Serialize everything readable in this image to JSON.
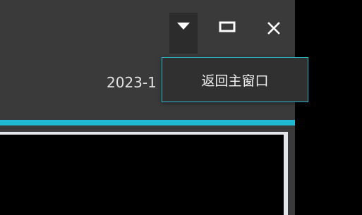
{
  "window_controls": {
    "dropdown_icon": "caret-down-icon",
    "maximize_icon": "maximize-icon",
    "close_icon": "close-icon"
  },
  "status": {
    "date_text": "2023-1"
  },
  "dropdown_menu": {
    "items": [
      {
        "label": "返回主窗口"
      }
    ]
  },
  "colors": {
    "accent": "#1fb7d1",
    "window_bg": "#3a3a3a",
    "menu_border": "#2fb5cc"
  }
}
